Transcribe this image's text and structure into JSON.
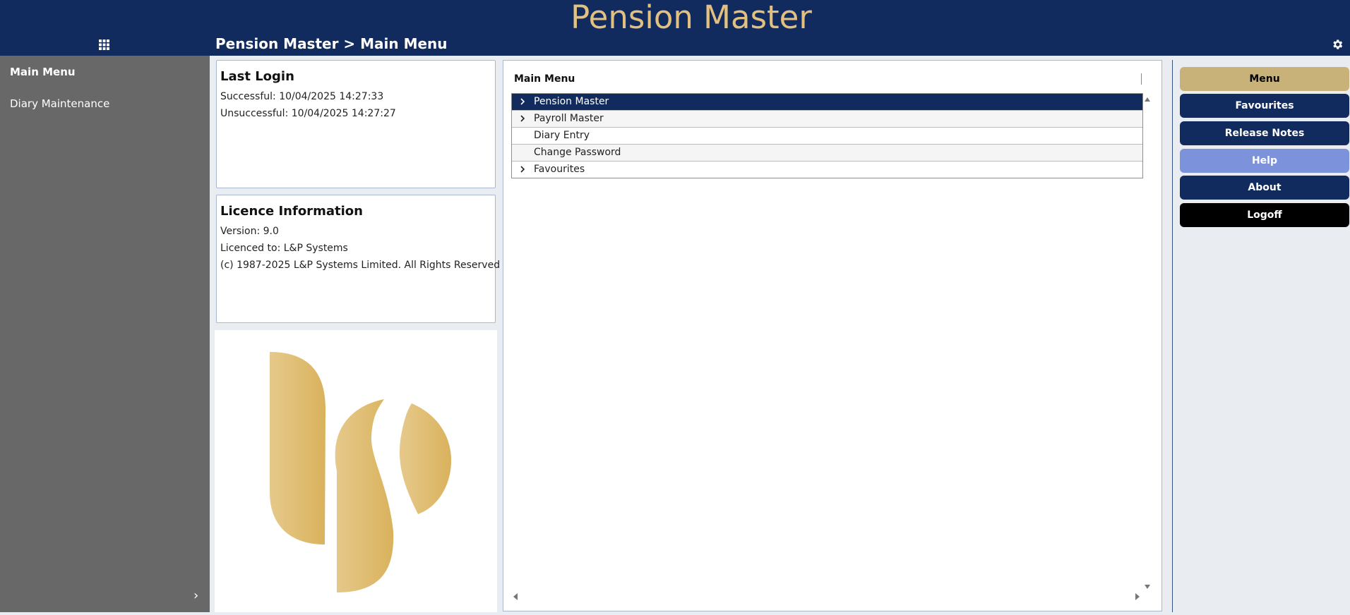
{
  "app": {
    "title": "Pension Master",
    "breadcrumb": "Pension Master > Main Menu"
  },
  "header_icons": {
    "apps": "grid-icon",
    "settings": "gear-icon"
  },
  "sidebar": {
    "items": [
      {
        "label": "Main Menu",
        "active": true
      },
      {
        "label": "Diary Maintenance",
        "active": false
      }
    ],
    "toggle": "›"
  },
  "last_login": {
    "title": "Last Login",
    "successful": "Successful: 10/04/2025 14:27:33",
    "unsuccessful": "Unsuccessful: 10/04/2025 14:27:27"
  },
  "licence": {
    "title": "Licence Information",
    "version": "Version: 9.0",
    "licenced_to": "Licenced to: L&P Systems",
    "copyright": "(c) 1987-2025 L&P Systems Limited. All Rights Reserved"
  },
  "main_menu": {
    "header": "Main Menu",
    "items": [
      {
        "label": "Pension Master",
        "expandable": true,
        "selected": true
      },
      {
        "label": "Payroll Master",
        "expandable": true,
        "selected": false
      },
      {
        "label": "Diary Entry",
        "expandable": false,
        "selected": false
      },
      {
        "label": "Change Password",
        "expandable": false,
        "selected": false
      },
      {
        "label": "Favourites",
        "expandable": true,
        "selected": false
      }
    ]
  },
  "right_buttons": [
    {
      "label": "Menu",
      "color": "#c9b27a",
      "text_color": "#000000"
    },
    {
      "label": "Favourites",
      "color": "#122b5e",
      "text_color": "#ffffff"
    },
    {
      "label": "Release Notes",
      "color": "#122b5e",
      "text_color": "#ffffff"
    },
    {
      "label": "Help",
      "color": "#7c93dc",
      "text_color": "#ffffff"
    },
    {
      "label": "About",
      "color": "#122b5e",
      "text_color": "#ffffff"
    },
    {
      "label": "Logoff",
      "color": "#000000",
      "text_color": "#ffffff"
    }
  ],
  "colors": {
    "header_bg": "#122b5e",
    "title_gold": "#e2c07f",
    "sidebar_bg": "#686868",
    "logo_gold": "#dcb866"
  }
}
